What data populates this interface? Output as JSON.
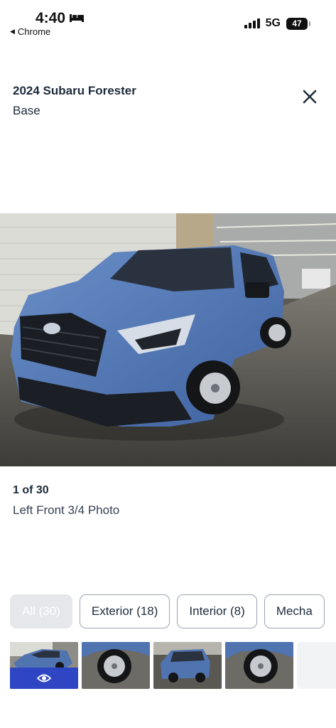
{
  "status_bar": {
    "time": "4:40",
    "back_app": "Chrome",
    "network": "5G",
    "battery": "47"
  },
  "header": {
    "title": "2024 Subaru Forester",
    "subtitle": "Base"
  },
  "photo_caption": {
    "counter": "1 of 30",
    "label": "Left Front 3/4 Photo"
  },
  "filters": [
    {
      "label": "All (30)",
      "active": true
    },
    {
      "label": "Exterior (18)",
      "active": false
    },
    {
      "label": "Interior (8)",
      "active": false
    },
    {
      "label": "Mecha",
      "active": false
    }
  ],
  "colors": {
    "selected_thumb_bar": "#2e46c4",
    "vehicle_blue": "#4f74b0"
  }
}
